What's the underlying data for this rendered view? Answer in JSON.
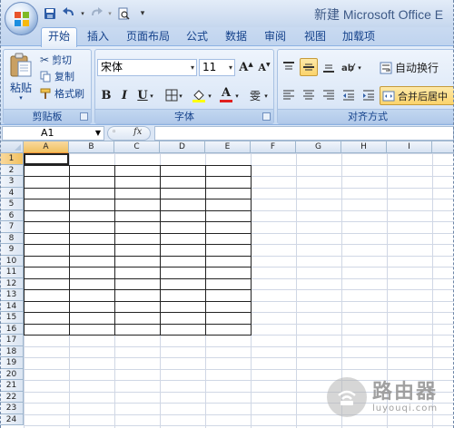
{
  "window": {
    "title": "新建 Microsoft Office E"
  },
  "tabs": [
    {
      "label": "开始",
      "active": true
    },
    {
      "label": "插入",
      "active": false
    },
    {
      "label": "页面布局",
      "active": false
    },
    {
      "label": "公式",
      "active": false
    },
    {
      "label": "数据",
      "active": false
    },
    {
      "label": "审阅",
      "active": false
    },
    {
      "label": "视图",
      "active": false
    },
    {
      "label": "加载项",
      "active": false
    }
  ],
  "clipboard": {
    "paste_label": "粘贴",
    "cut_label": "剪切",
    "copy_label": "复制",
    "format_painter_label": "格式刷",
    "group_label": "剪贴板"
  },
  "font": {
    "font_name": "宋体",
    "font_size": "11",
    "grow_label": "A",
    "shrink_label": "A",
    "bold_label": "B",
    "italic_label": "I",
    "underline_label": "U",
    "phonetic_label": "雯",
    "font_color_label": "A",
    "group_label": "字体"
  },
  "alignment": {
    "wrap_text_label": "自动换行",
    "merge_center_label": "合并后居中",
    "group_label": "对齐方式"
  },
  "formula_bar": {
    "name_box": "A1",
    "fx_label": "fx",
    "formula": ""
  },
  "sheet": {
    "columns": [
      "A",
      "B",
      "C",
      "D",
      "E",
      "F",
      "G",
      "H",
      "I"
    ],
    "rows": [
      "1",
      "2",
      "3",
      "4",
      "5",
      "6",
      "7",
      "8",
      "9",
      "10",
      "11",
      "12",
      "13",
      "14",
      "15",
      "16",
      "17",
      "18",
      "19",
      "20",
      "21",
      "22",
      "23",
      "24"
    ],
    "selected_cell": "A1",
    "bordered_range": "A2:E16"
  },
  "watermark": {
    "title": "路由器",
    "url": "luyouqi.com"
  },
  "colors": {
    "ribbon_text": "#15428b",
    "selected_header": "#f1c15f",
    "font_color_bar": "#e02020",
    "fill_color_bar": "#ffff00"
  }
}
